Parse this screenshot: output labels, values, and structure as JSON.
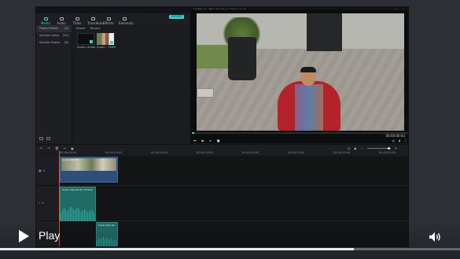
{
  "app": {
    "window_title": "Untitled - Wondershare Filmora 9",
    "export_label": "EXPORT"
  },
  "toolbar": {
    "tabs": [
      {
        "label": "Media",
        "icon": "folder-icon"
      },
      {
        "label": "Audio",
        "icon": "music-icon"
      },
      {
        "label": "Titles",
        "icon": "text-icon"
      },
      {
        "label": "Transitions",
        "icon": "transition-icon"
      },
      {
        "label": "Effects",
        "icon": "effects-icon"
      },
      {
        "label": "Elements",
        "icon": "elements-icon"
      }
    ]
  },
  "sidebar": {
    "items": [
      {
        "label": "Project Media",
        "count": "(3)"
      },
      {
        "label": "Sample Colors",
        "count": "(25)"
      },
      {
        "label": "Sample Videos",
        "count": "(8)"
      }
    ]
  },
  "media": {
    "import_label": "Import",
    "record_label": "Record",
    "items": [
      {
        "label": "Super...audio"
      },
      {
        "label": "Super... Video"
      }
    ]
  },
  "preview": {
    "timecode": "00:00:00:03",
    "progress": 0.01
  },
  "timeline": {
    "ruler": [
      "00:00:00:00",
      "00:00:05:00",
      "00:00:10:00",
      "00:00:15:00",
      "00:00:20:00",
      "00:00:25:00",
      "00:00:30:00",
      "00:00:35:00",
      "00:00:40:00"
    ],
    "video_clip_label": "Super Awe Re...",
    "audio_clip_label": "Super Awe Re Ver Of Tade",
    "audio_clip2_label": "Super Awe Re"
  },
  "player": {
    "play_label": "Play",
    "progress": 0.77
  }
}
